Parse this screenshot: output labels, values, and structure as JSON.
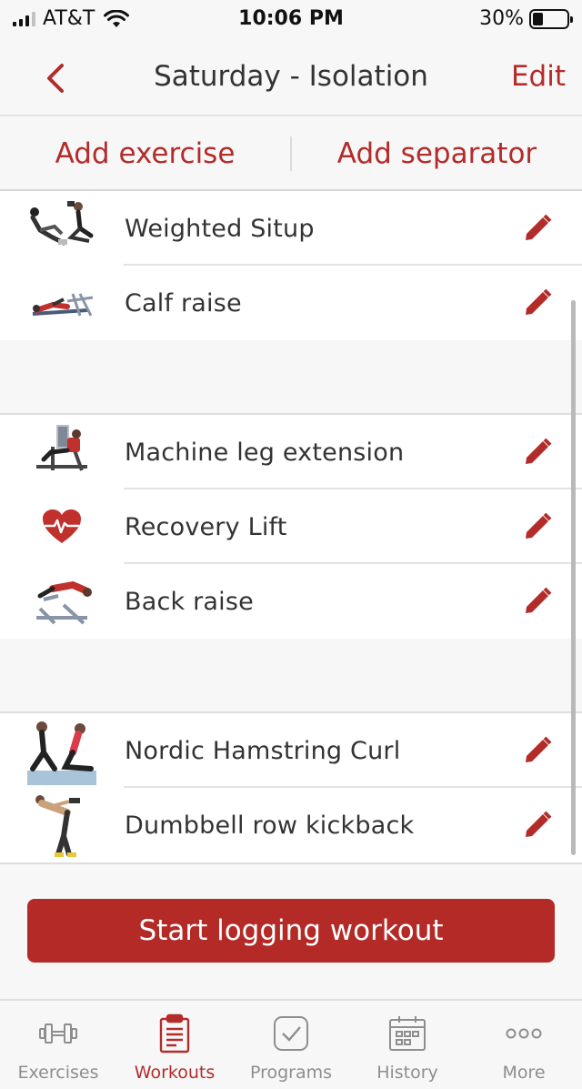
{
  "status_bar": {
    "carrier": "AT&T",
    "time": "10:06 PM",
    "battery": "30%",
    "battery_level": 0.3
  },
  "nav": {
    "title": "Saturday - Isolation",
    "edit_label": "Edit"
  },
  "actions": {
    "add_exercise": "Add exercise",
    "add_separator": "Add separator"
  },
  "groups": [
    {
      "items": [
        {
          "label": "Weighted Situp",
          "icon": "situp-thumbnail"
        },
        {
          "label": "Calf raise",
          "icon": "calf-raise-thumbnail"
        }
      ]
    },
    {
      "items": [
        {
          "label": "Machine leg extension",
          "icon": "leg-extension-thumbnail"
        },
        {
          "label": "Recovery Lift",
          "icon": "heart-icon"
        },
        {
          "label": "Back raise",
          "icon": "back-raise-thumbnail"
        }
      ]
    },
    {
      "items": [
        {
          "label": "Nordic Hamstring Curl",
          "icon": "nordic-curl-thumbnail"
        },
        {
          "label": "Dumbbell row kickback",
          "icon": "dumbbell-row-thumbnail"
        }
      ]
    }
  ],
  "start_button": "Start logging workout",
  "tabs": [
    {
      "label": "Exercises",
      "icon": "dumbbell-icon",
      "active": false
    },
    {
      "label": "Workouts",
      "icon": "clipboard-icon",
      "active": true
    },
    {
      "label": "Programs",
      "icon": "checkmark-icon",
      "active": false
    },
    {
      "label": "History",
      "icon": "calendar-icon",
      "active": false
    },
    {
      "label": "More",
      "icon": "more-dots-icon",
      "active": false
    }
  ],
  "colors": {
    "accent": "#b22c2a",
    "tab_inactive": "#8e8e8e",
    "background": "#f7f7f7"
  }
}
